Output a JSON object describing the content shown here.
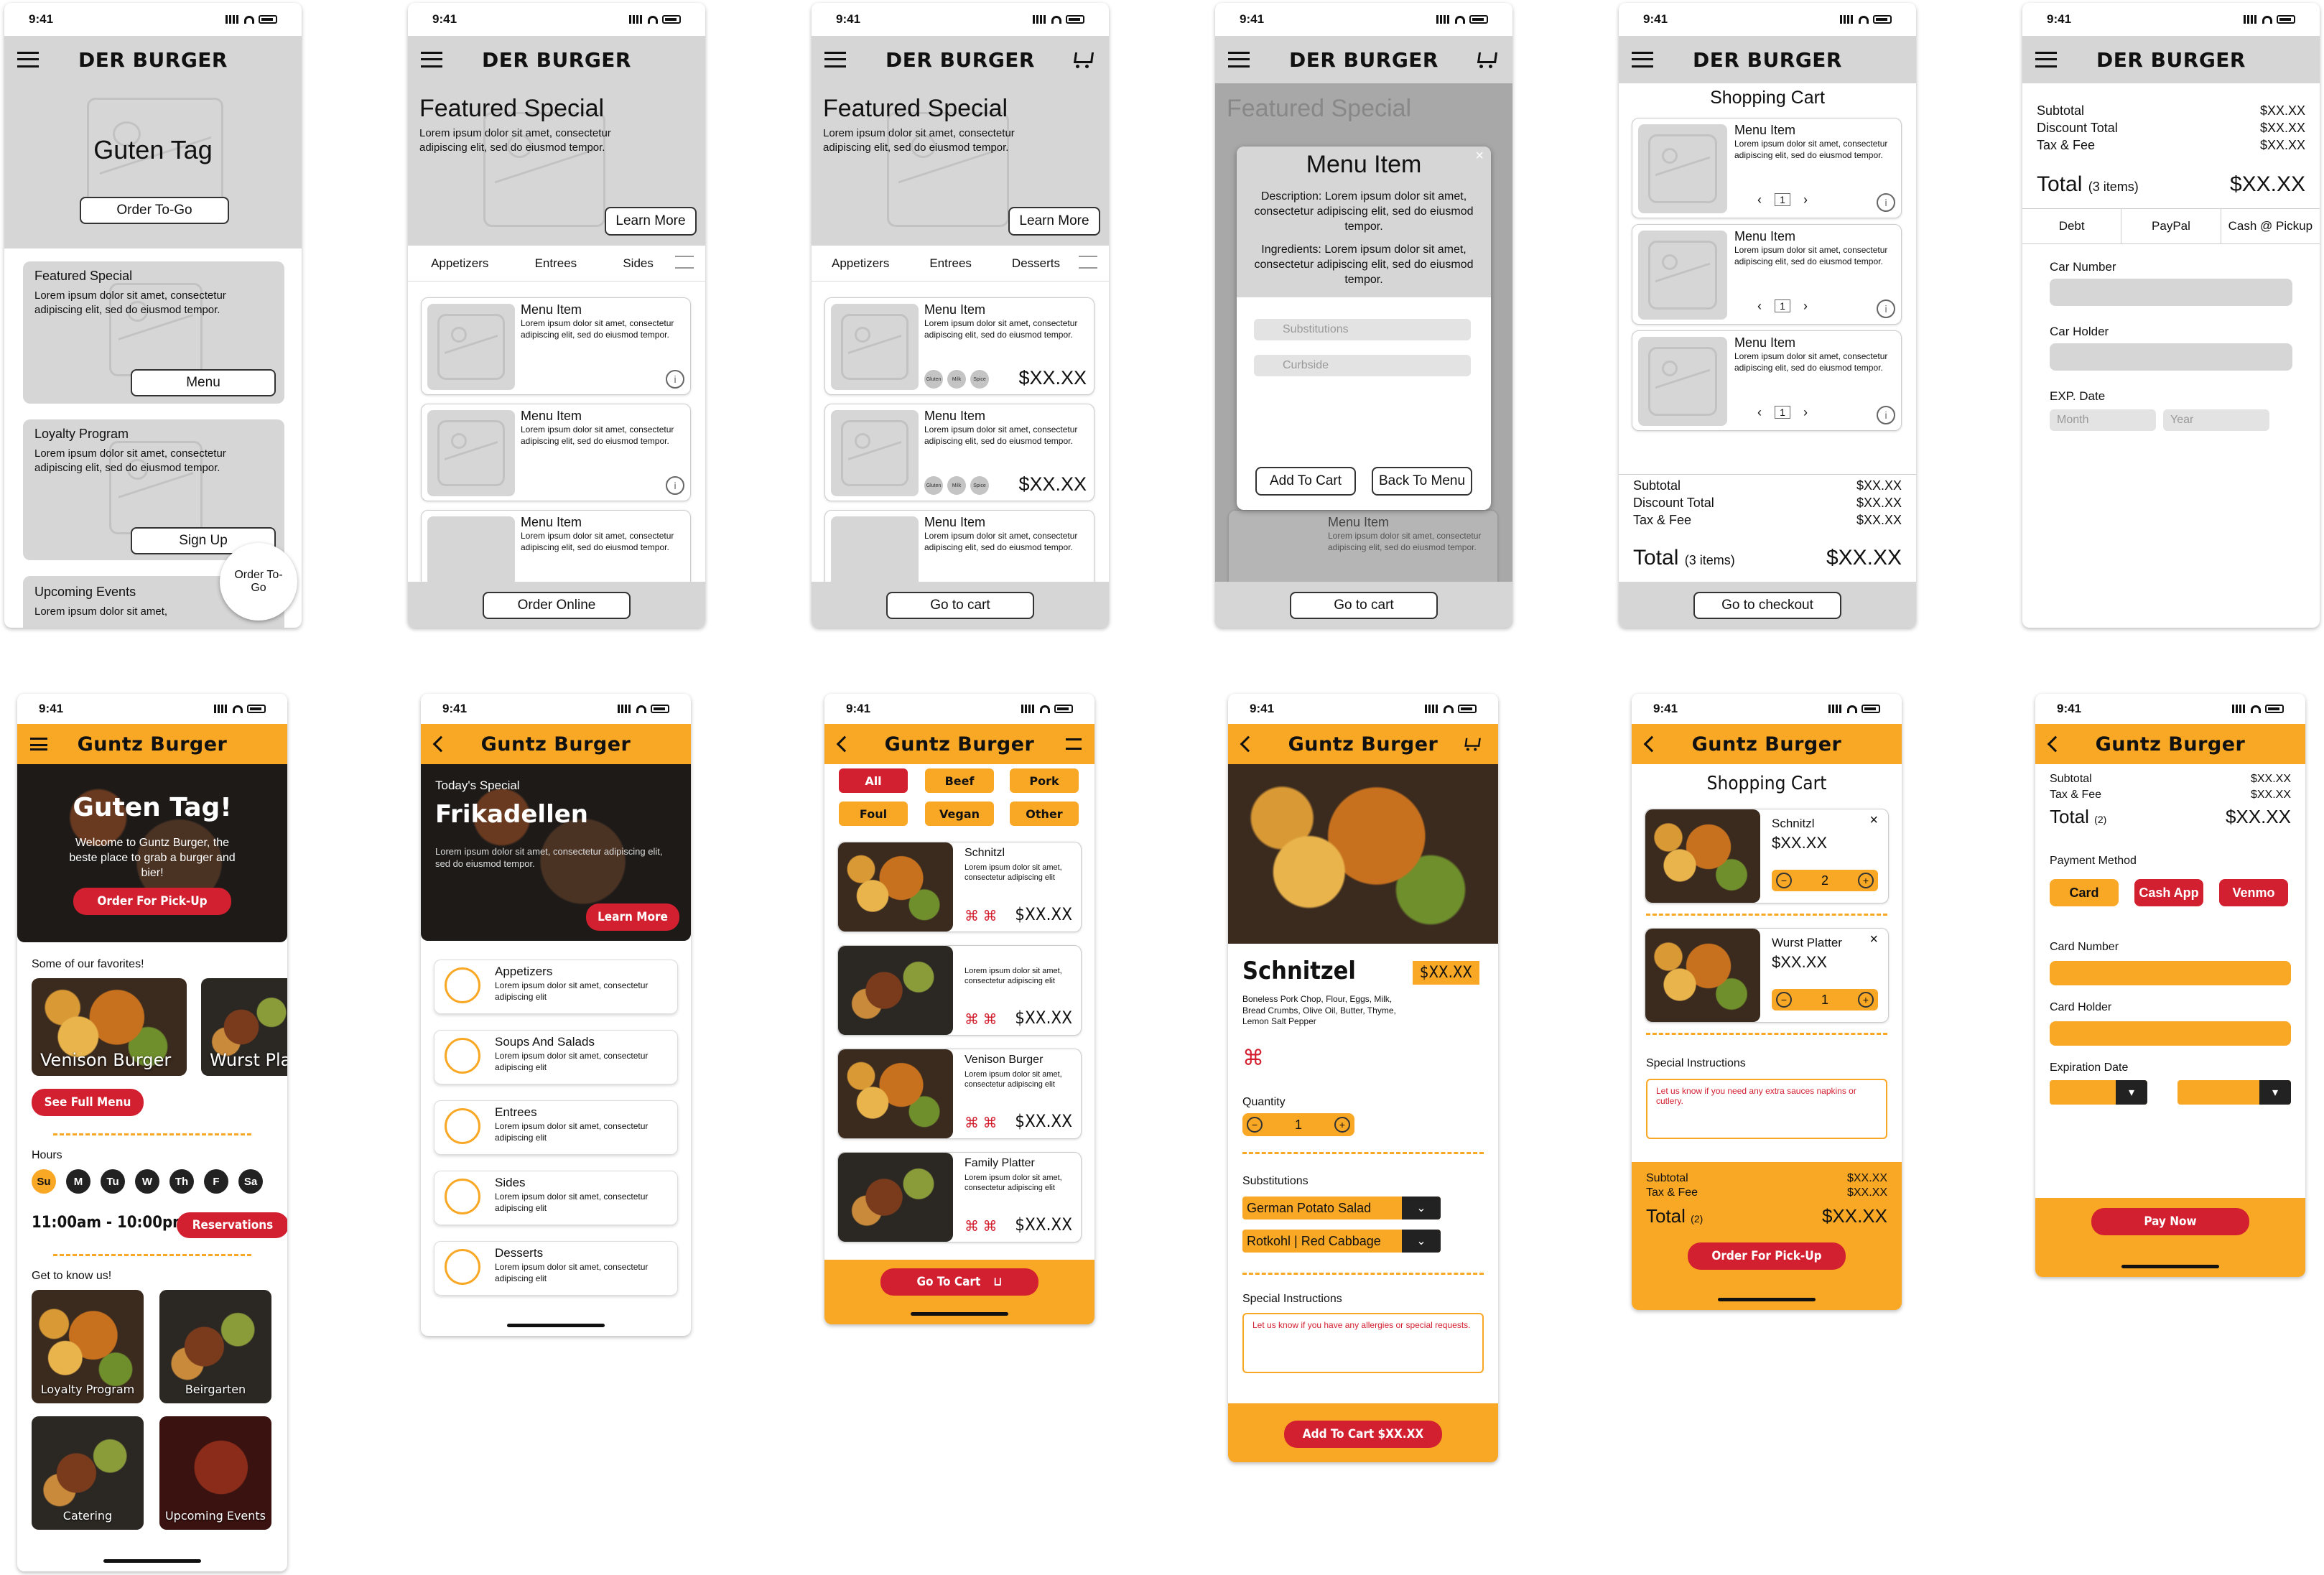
{
  "status_time": "9:41",
  "wf": {
    "brand": "DER BURGER",
    "s1": {
      "hero": "Guten Tag",
      "order_btn": "Order To-Go",
      "featured_title": "Featured Special",
      "lorem": "Lorem ipsum dolor sit amet, consectetur adipiscing elit, sed do eiusmod tempor.",
      "menu_btn": "Menu",
      "loyalty_title": "Loyalty Program",
      "signup_btn": "Sign Up",
      "events_title": "Upcoming Events",
      "events_text": "Lorem ipsum dolor sit amet,",
      "fab": "Order To-Go"
    },
    "s2": {
      "title": "Featured Special",
      "learn": "Learn More",
      "tabs": [
        "Appetizers",
        "Entrees",
        "Sides"
      ],
      "item": "Menu Item",
      "order_online": "Order Online"
    },
    "s3": {
      "tabs": [
        "Appetizers",
        "Entrees",
        "Desserts"
      ],
      "price": "$XX.XX",
      "pills": [
        "Gluten",
        "Milk",
        "Spice"
      ],
      "go_cart": "Go to cart"
    },
    "s4": {
      "modal_title": "Menu Item",
      "description": "Description: Lorem ipsum dolor sit amet, consectetur adipiscing elit, sed do eiusmod tempor.",
      "ingredients": "Ingredients: Lorem ipsum dolor sit amet, consectetur adipiscing elit, sed do eiusmod tempor.",
      "sub_select": "Substitutions",
      "curbside_select": "Curbside",
      "add_btn": "Add To Cart",
      "back_btn": "Back To Menu"
    },
    "s5": {
      "title": "Shopping Cart",
      "qty": "1",
      "subtotal": "Subtotal",
      "discount": "Discount Total",
      "tax": "Tax & Fee",
      "total": "Total",
      "items": "(3 items)",
      "checkout": "Go to checkout"
    },
    "s6": {
      "payments": [
        "Debt",
        "PayPal",
        "Cash @ Pickup"
      ],
      "card_number": "Car Number",
      "card_holder": "Car Holder",
      "exp": "EXP. Date",
      "month": "Month",
      "year": "Year"
    }
  },
  "hifi": {
    "brand": "Guntz Burger",
    "h1": {
      "hero_title": "Guten Tag!",
      "hero_text": "Welcome to Guntz Burger, the beste place to grab a burger and bier!",
      "pickup": "Order For Pick-Up",
      "favorites": "Some of our favorites!",
      "fav1": "Venison Burger",
      "fav2": "Wurst Plat",
      "see_menu": "See Full Menu",
      "hours": "Hours",
      "days": [
        "Su",
        "M",
        "Tu",
        "W",
        "Th",
        "F",
        "Sa"
      ],
      "time": "11:00am - 10:00pm",
      "reservations": "Reservations",
      "know": "Get to know us!",
      "tiles": [
        "Loyalty Program",
        "Beirgarten",
        "Catering",
        "Upcoming Events"
      ]
    },
    "h2": {
      "todays": "Today's Special",
      "special": "Frikadellen",
      "lorem": "Lorem ipsum dolor sit amet, consectetur adipiscing elit, sed do eiusmod tempor.",
      "learn": "Learn More",
      "cats": [
        {
          "name": "Appetizers",
          "text": "Lorem ipsum dolor sit amet, consectetur adipiscing elit"
        },
        {
          "name": "Soups And Salads",
          "text": "Lorem ipsum dolor sit amet, consectetur adipiscing elit"
        },
        {
          "name": "Entrees",
          "text": "Lorem ipsum dolor sit amet, consectetur adipiscing elit"
        },
        {
          "name": "Sides",
          "text": "Lorem ipsum dolor sit amet, consectetur adipiscing elit"
        },
        {
          "name": "Desserts",
          "text": "Lorem ipsum dolor sit amet, consectetur adipiscing elit"
        }
      ]
    },
    "h3": {
      "filters": [
        "All",
        "Beef",
        "Pork",
        "Foul",
        "Vegan",
        "Other"
      ],
      "items": [
        "Schnitzl",
        "",
        "Venison Burger",
        "Family Platter"
      ],
      "desc": "Lorem ipsum dolor sit amet, consectetur adipiscing elit",
      "go_cart": "Go To Cart"
    },
    "h4": {
      "name": "Schnitzel",
      "ingredients": "Boneless Pork Chop, Flour, Eggs, Milk, Bread Crumbs, Olive Oil, Butter, Thyme, Lemon Salt Pepper",
      "quantity": "Quantity",
      "qty": "1",
      "subs": "Substitutions",
      "sub1": "German Potato Salad",
      "sub2": "Rotkohl | Red Cabbage",
      "special": "Special Instructions",
      "placeholder": "Let us know if you have any allergies or special requests.",
      "add": "Add To Cart $XX.XX"
    },
    "h5": {
      "title": "Shopping Cart",
      "item1": "Schnitzl",
      "qty1": "2",
      "item2": "Wurst Platter",
      "qty2": "1",
      "special": "Special Instructions",
      "placeholder": "Let us know if you need any extra sauces napkins or cutlery.",
      "subtotal": "Subtotal",
      "tax": "Tax & Fee",
      "total": "Total",
      "count": "(2)",
      "order": "Order For Pick-Up"
    },
    "h6": {
      "subtotal": "Subtotal",
      "tax": "Tax & Fee",
      "total": "Total",
      "count": "(2)",
      "payment": "Payment Method",
      "methods": [
        "Card",
        "Cash App",
        "Venmo"
      ],
      "card_number": "Card Number",
      "card_holder": "Card Holder",
      "exp": "Expiration Date",
      "pay": "Pay Now"
    }
  },
  "price": "$XX.XX",
  "colors": {
    "accent": "#f9a825",
    "red": "#d32030",
    "wire": "#d6d6d6"
  }
}
